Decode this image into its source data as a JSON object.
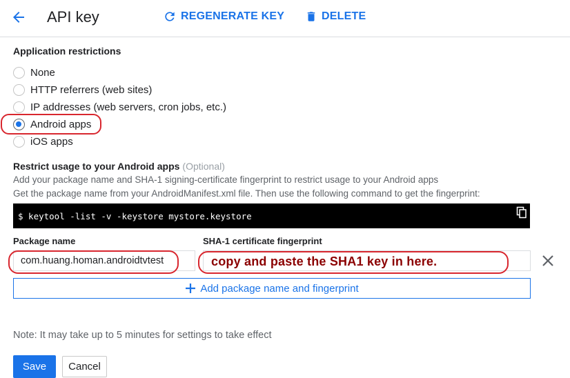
{
  "header": {
    "title": "API key",
    "regenerate_label": "REGENERATE KEY",
    "delete_label": "DELETE",
    "back_icon": "arrow-back-icon",
    "regenerate_icon": "refresh-icon",
    "delete_icon": "trash-icon"
  },
  "restrictions": {
    "title": "Application restrictions",
    "options": [
      {
        "label": "None",
        "checked": false
      },
      {
        "label": "HTTP referrers (web sites)",
        "checked": false
      },
      {
        "label": "IP addresses (web servers, cron jobs, etc.)",
        "checked": false
      },
      {
        "label": "Android apps",
        "checked": true
      },
      {
        "label": "iOS apps",
        "checked": false
      }
    ]
  },
  "android": {
    "title": "Restrict usage to your Android apps",
    "optional": "(Optional)",
    "help_line1": "Add your package name and SHA-1 signing-certificate fingerprint to restrict usage to your Android apps",
    "help_line2": "Get the package name from your AndroidManifest.xml file. Then use the following command to get the fingerprint:",
    "command": "$ keytool -list -v -keystore mystore.keystore",
    "package_label": "Package name",
    "package_value": "com.huang.homan.androidtvtest",
    "sha_label": "SHA-1 certificate fingerprint",
    "sha_value": "",
    "annotation": "copy and paste the SHA1 key in here.",
    "add_label": "Add package name and fingerprint"
  },
  "footer": {
    "note": "Note: It may take up to 5 minutes for settings to take effect",
    "save_label": "Save",
    "cancel_label": "Cancel"
  },
  "colors": {
    "accent": "#1a73e8",
    "annotation_outline": "#d8262e",
    "annotation_text": "#8b0000"
  }
}
